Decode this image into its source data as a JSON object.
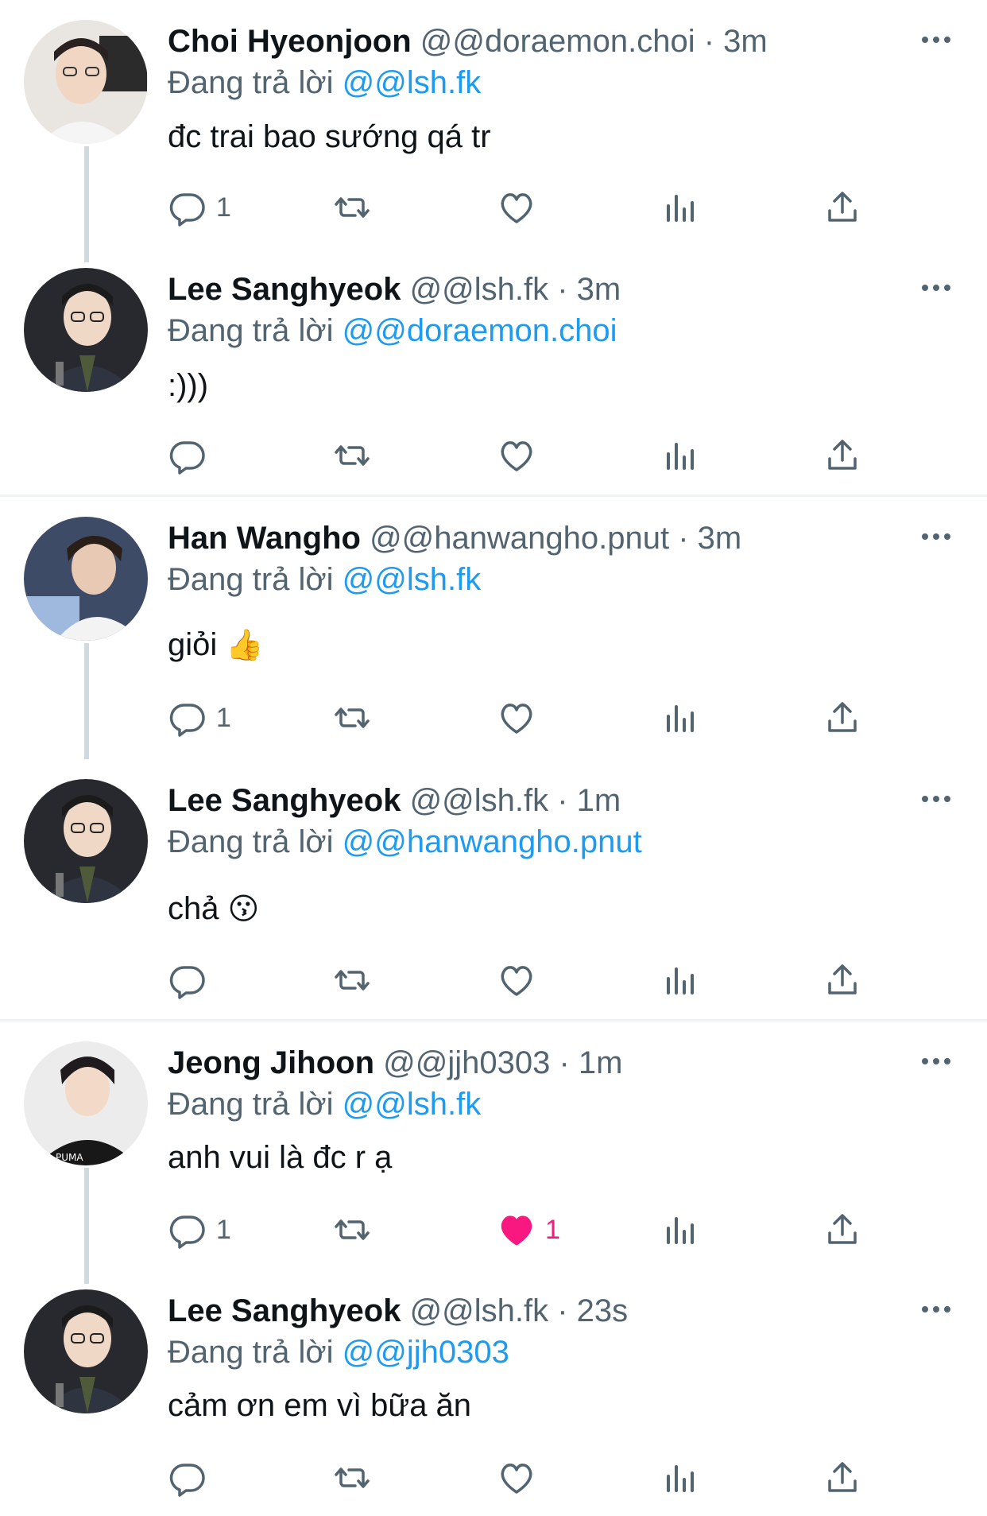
{
  "colors": {
    "accent": "#1d9bf0",
    "like": "#f91880",
    "muted": "#536471",
    "text": "#0f1419"
  },
  "tweets": [
    {
      "name": "Choi Hyeonjoon",
      "meta": "@@doraemon.choi · 3m",
      "reply_prefix": "Đang trả lời",
      "reply_to": "@@lsh.fk",
      "text": "đc trai bao sướng qá tr",
      "emoji": "",
      "reply_count": "1",
      "like_count": "",
      "liked": false
    },
    {
      "name": "Lee Sanghyeok",
      "meta": "@@lsh.fk · 3m",
      "reply_prefix": "Đang trả lời",
      "reply_to": "@@doraemon.choi",
      "text": ":)))",
      "emoji": "",
      "reply_count": "",
      "like_count": "",
      "liked": false
    },
    {
      "name": "Han Wangho",
      "meta": "@@hanwangho.pnut · 3m",
      "reply_prefix": "Đang trả lời",
      "reply_to": "@@lsh.fk",
      "text": "giỏi",
      "emoji": "👍",
      "reply_count": "1",
      "like_count": "",
      "liked": false
    },
    {
      "name": "Lee Sanghyeok",
      "meta": "@@lsh.fk · 1m",
      "reply_prefix": "Đang trả lời",
      "reply_to": "@@hanwangho.pnut",
      "text": "chả",
      "emoji": "😗",
      "reply_count": "",
      "like_count": "",
      "liked": false
    },
    {
      "name": "Jeong Jihoon",
      "meta": "@@jjh0303 · 1m",
      "reply_prefix": "Đang trả lời",
      "reply_to": "@@lsh.fk",
      "text": "anh vui là đc r ạ",
      "emoji": "",
      "reply_count": "1",
      "like_count": "1",
      "liked": true
    },
    {
      "name": "Lee Sanghyeok",
      "meta": "@@lsh.fk · 23s",
      "reply_prefix": "Đang trả lời",
      "reply_to": "@@jjh0303",
      "text": "cảm ơn em vì bữa ăn",
      "emoji": "",
      "reply_count": "",
      "like_count": "",
      "liked": false
    }
  ],
  "icons": [
    "reply-icon",
    "retweet-icon",
    "like-icon",
    "views-icon",
    "share-icon",
    "more-icon"
  ]
}
